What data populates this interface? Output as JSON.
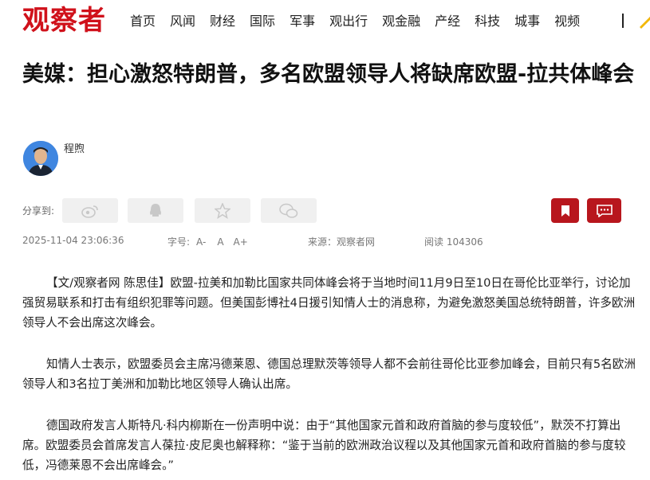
{
  "header": {
    "logo": "观察者",
    "nav": [
      "首页",
      "风闻",
      "财经",
      "国际",
      "军事",
      "观出行",
      "观金融",
      "产经",
      "科技",
      "城事",
      "视频"
    ]
  },
  "article": {
    "title": "美媒：担心激怒特朗普，多名欧盟领导人将缺席欧盟-拉共体峰会",
    "author": "程煦",
    "share_label": "分享到:",
    "date": "2025-11-04 23:06:36",
    "font_label": "字号:",
    "font_a_minus": "A-",
    "font_a": "A",
    "font_a_plus": "A+",
    "source": "来源：观察者网",
    "views": "阅读 104306",
    "paragraphs": [
      "【文/观察者网 陈思佳】欧盟-拉美和加勒比国家共同体峰会将于当地时间11月9日至10日在哥伦比亚举行，讨论加强贸易联系和打击有组织犯罪等问题。但美国彭博社4日援引知情人士的消息称，为避免激怒美国总统特朗普，许多欧洲领导人不会出席这次峰会。",
      "知情人士表示，欧盟委员会主席冯德莱恩、德国总理默茨等领导人都不会前往哥伦比亚参加峰会，目前只有5名欧洲领导人和3名拉丁美洲和加勒比地区领导人确认出席。",
      "德国政府发言人斯特凡·科内柳斯在一份声明中说：由于“其他国家元首和政府首脑的参与度较低”，默茨不打算出席。欧盟委员会首席发言人葆拉·皮尼奥也解释称：“鉴于当前的欧洲政治议程以及其他国家元首和政府首脑的参与度较低，冯德莱恩不会出席峰会。”"
    ]
  },
  "colors": {
    "brand": "#d0111b",
    "action": "#b8161d"
  }
}
